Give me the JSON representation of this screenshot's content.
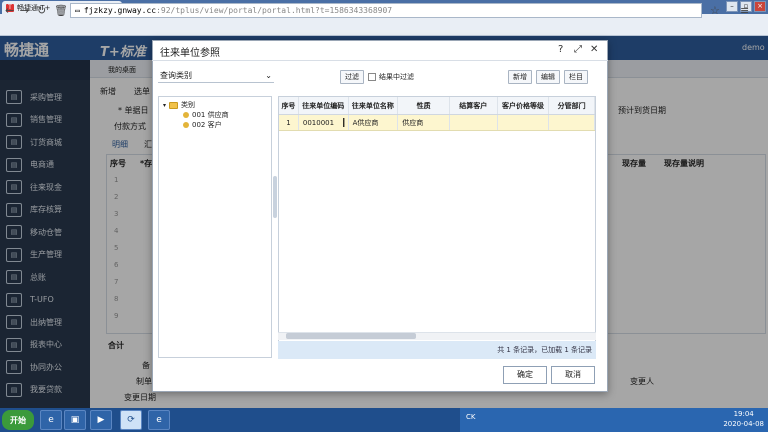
{
  "browser": {
    "tab_title": "畅捷通 T+",
    "tab_close": "×",
    "url_host": "fjzkzy.gnway.cc",
    "url_path": ":92/tplus/view/portal/portal.html?t=1586343368907"
  },
  "app": {
    "logo": "畅捷通",
    "product": "T+标准",
    "user": "demo"
  },
  "sidebar": {
    "items": [
      {
        "label": "采购管理",
        "icon": "cart-icon"
      },
      {
        "label": "销售管理",
        "icon": "sales-icon"
      },
      {
        "label": "订货商城",
        "icon": "shop-icon"
      },
      {
        "label": "电商通",
        "icon": "ecommerce-icon"
      },
      {
        "label": "往来现金",
        "icon": "cash-icon"
      },
      {
        "label": "库存核算",
        "icon": "inventory-icon"
      },
      {
        "label": "移动仓管",
        "icon": "mobile-warehouse-icon"
      },
      {
        "label": "生产管理",
        "icon": "production-icon"
      },
      {
        "label": "总账",
        "icon": "ledger-icon"
      },
      {
        "label": "T-UFO",
        "icon": "ufo-icon"
      },
      {
        "label": "出纳管理",
        "icon": "cashier-icon"
      },
      {
        "label": "报表中心",
        "icon": "report-icon"
      },
      {
        "label": "协同办公",
        "icon": "office-icon"
      },
      {
        "label": "我要贷款",
        "icon": "loan-icon"
      }
    ]
  },
  "background": {
    "tab_home": "我的桌面",
    "new_label": "新增",
    "select_label": "选单",
    "field_date": "* 单据日",
    "field_pay": "付款方式",
    "tab_detail": "明细",
    "tab_summary": "汇",
    "col_seq": "序号",
    "col_stock": "*存",
    "col_qty": "现存量",
    "col_qty_desc": "现存量说明",
    "total_label": "合计",
    "due_label": "预计到货日期",
    "maker_label": "制单",
    "memo_label": "备",
    "change_label": "变更人",
    "change_date_label": "变更日期",
    "row_numbers": [
      "1",
      "2",
      "3",
      "4",
      "5",
      "6",
      "7",
      "8",
      "9"
    ]
  },
  "dialog": {
    "title": "往来单位参照",
    "help": "?",
    "maximize": "⤢",
    "close": "✕",
    "query_select": "查询类别",
    "filter_button": "过滤",
    "filter_in_result": "结果中过滤",
    "new_button": "新增",
    "edit_button": "编辑",
    "columns_button": "栏目",
    "tree": {
      "root": "类别",
      "children": [
        "001 供应商",
        "002 客户"
      ]
    },
    "grid": {
      "headers": [
        "序号",
        "往来单位编码",
        "往来单位名称",
        "性质",
        "结算客户",
        "客户价格等级",
        "分管部门"
      ],
      "rows": [
        [
          "1",
          "0010001",
          "A供应商",
          "供应商",
          "",
          "",
          ""
        ]
      ]
    },
    "status_text": "共 1 条记录，已加载 1 条记录",
    "ok_button": "确定",
    "cancel_button": "取消"
  },
  "taskbar": {
    "start": "开始",
    "tray_lang": "CK",
    "time": "19:04",
    "date": "2020-04-08"
  }
}
